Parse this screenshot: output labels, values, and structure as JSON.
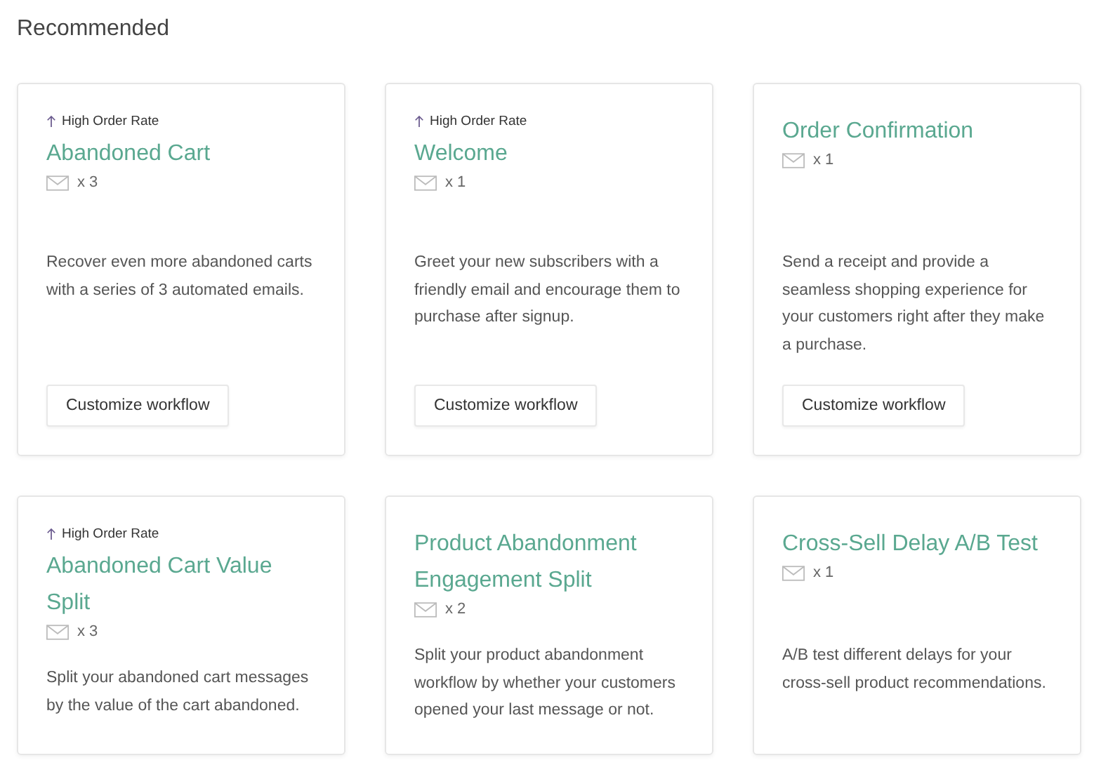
{
  "heading": "Recommended",
  "cards": [
    {
      "badge": "High Order Rate",
      "title": "Abandoned Cart",
      "count": "x 3",
      "description": "Recover even more abandoned carts with a series of 3 automated emails.",
      "button": "Customize workflow"
    },
    {
      "badge": "High Order Rate",
      "title": "Welcome",
      "count": "x 1",
      "description": "Greet your new subscribers with a friendly email and encourage them to purchase after signup.",
      "button": "Customize workflow"
    },
    {
      "title": "Order Confirmation",
      "count": "x 1",
      "description": "Send a receipt and provide a seamless shopping experience for your customers right after they make a purchase.",
      "button": "Customize workflow"
    },
    {
      "badge": "High Order Rate",
      "title": "Abandoned Cart Value Split",
      "count": "x 3",
      "description": "Split your abandoned cart messages by the value of the cart abandoned."
    },
    {
      "title": "Product Abandonment Engagement Split",
      "count": "x 2",
      "description": "Split your product abandonment workflow by whether your customers opened your last message or not."
    },
    {
      "title": "Cross-Sell Delay A/B Test",
      "count": "x 1",
      "description": "A/B test different delays for your cross-sell product recommendations."
    }
  ]
}
